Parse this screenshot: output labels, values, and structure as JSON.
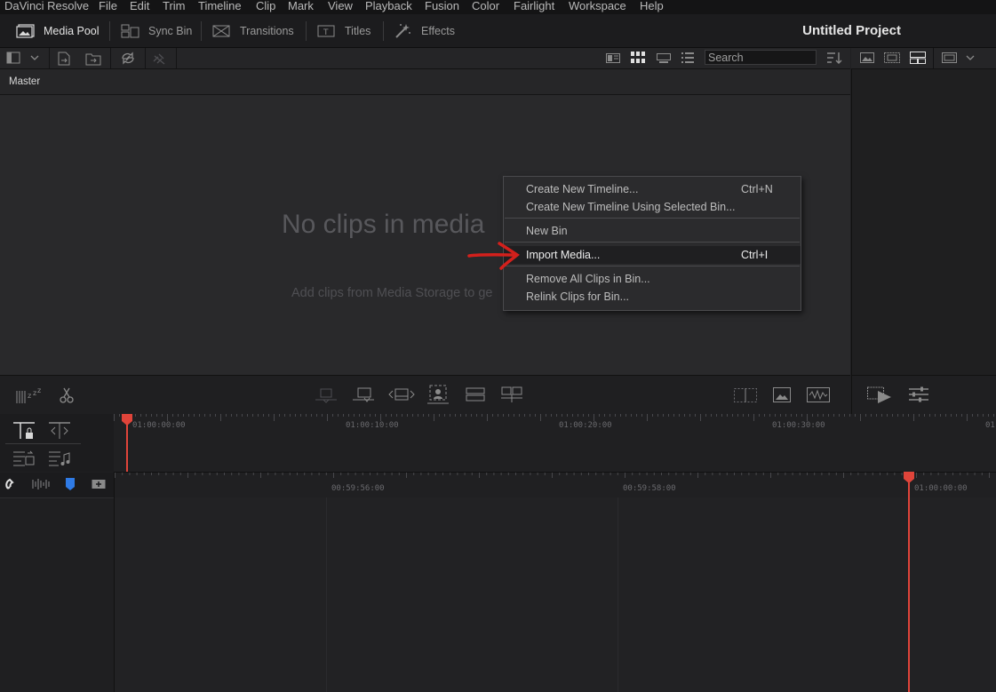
{
  "menu": {
    "items": [
      "DaVinci Resolve",
      "File",
      "Edit",
      "Trim",
      "Timeline",
      "Clip",
      "Mark",
      "View",
      "Playback",
      "Fusion",
      "Color",
      "Fairlight",
      "Workspace",
      "Help"
    ]
  },
  "toolbar": {
    "media_pool": "Media Pool",
    "sync_bin": "Sync Bin",
    "transitions": "Transitions",
    "titles": "Titles",
    "effects": "Effects",
    "project_title": "Untitled Project"
  },
  "media_pool": {
    "search_placeholder": "Search",
    "bin_name": "Master",
    "empty_title": "No clips in media",
    "empty_subtitle": "Add clips from Media Storage to ge"
  },
  "context_menu": {
    "items": [
      {
        "label": "Create New Timeline...",
        "shortcut": "Ctrl+N"
      },
      {
        "label": "Create New Timeline Using Selected Bin...",
        "shortcut": ""
      },
      {
        "label": "New Bin",
        "shortcut": ""
      },
      {
        "label": "Import Media...",
        "shortcut": "Ctrl+I",
        "highlighted": true
      },
      {
        "label": "Remove All Clips in Bin...",
        "shortcut": ""
      },
      {
        "label": "Relink Clips for Bin...",
        "shortcut": ""
      }
    ]
  },
  "timeline": {
    "upper_ruler": [
      "01:00:00:00",
      "01:00:10:00",
      "01:00:20:00",
      "01:00:30:00",
      "01:"
    ],
    "lower_ruler": [
      "00:59:56:00",
      "00:59:58:00",
      "01:00:00:00"
    ]
  },
  "colors": {
    "playhead": "#e0443a",
    "annotation_arrow": "#d3201c",
    "flag_blue": "#2f7be6"
  }
}
